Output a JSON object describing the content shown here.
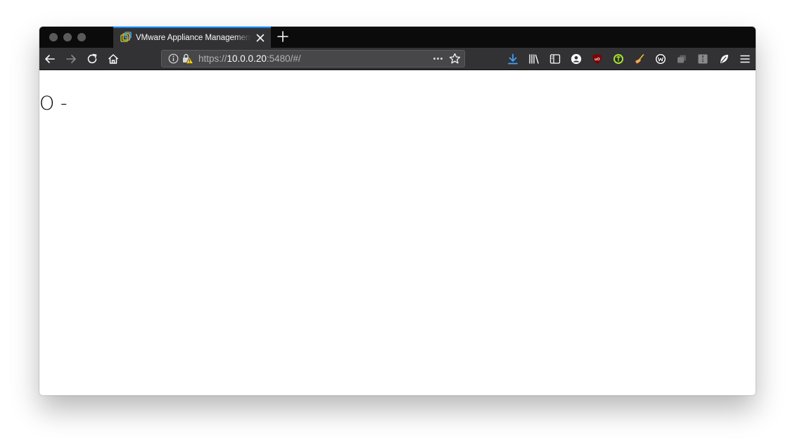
{
  "tab": {
    "title": "VMware Appliance Management"
  },
  "urlbar": {
    "scheme": "https://",
    "host": "10.0.0.20",
    "rest": ":5480/#/"
  },
  "content": {
    "text": "O -"
  },
  "colors": {
    "tab_accent": "#0a84ff",
    "download_icon": "#45a1ff",
    "toolbar_bg": "#323234",
    "tabstrip_bg": "#0b0b0b"
  }
}
